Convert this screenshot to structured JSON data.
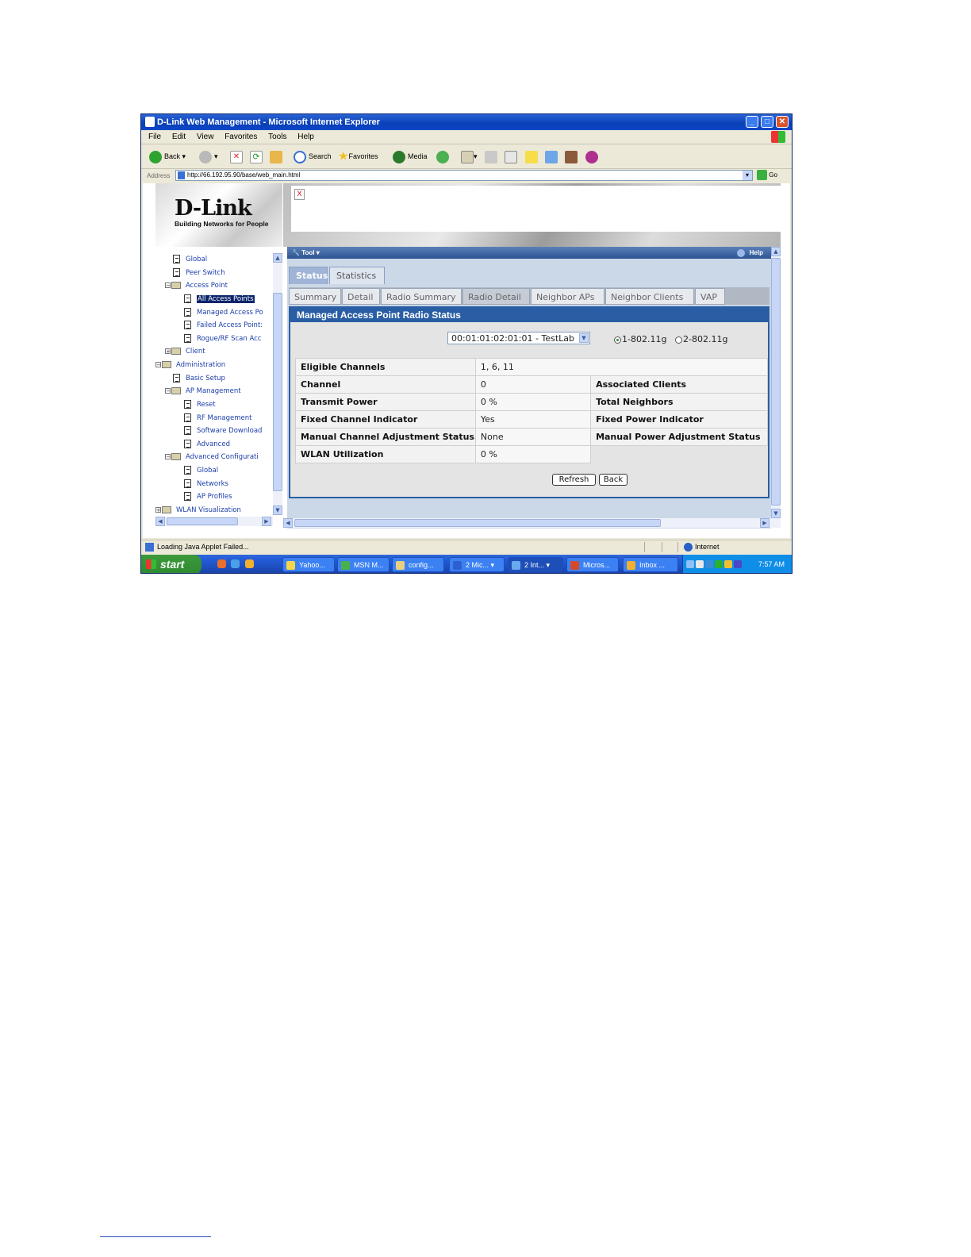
{
  "window": {
    "title": "D-Link Web Management - Microsoft Internet Explorer",
    "controls": [
      "minimize",
      "maximize",
      "close"
    ]
  },
  "menu": [
    "File",
    "Edit",
    "View",
    "Favorites",
    "Tools",
    "Help"
  ],
  "toolbar": {
    "back": "Back",
    "search": "Search",
    "favorites": "Favorites",
    "media": "Media"
  },
  "address": {
    "label": "Address",
    "url": "http://66.192.95.90/base/web_main.html",
    "go": "Go"
  },
  "logo": {
    "brand": "D-Link",
    "slogan": "Building Networks for People"
  },
  "nav_tree": [
    {
      "label": "Global"
    },
    {
      "label": "Peer Switch"
    },
    {
      "label": "Access Point"
    },
    {
      "label": "All Access Points"
    },
    {
      "label": "Managed Access Po"
    },
    {
      "label": "Failed Access Point:"
    },
    {
      "label": "Rogue/RF Scan Acc"
    },
    {
      "label": "Client"
    },
    {
      "label": "Administration"
    },
    {
      "label": "Basic Setup"
    },
    {
      "label": "AP Management"
    },
    {
      "label": "Reset"
    },
    {
      "label": "RF Management"
    },
    {
      "label": "Software Download"
    },
    {
      "label": "Advanced"
    },
    {
      "label": "Advanced Configurati"
    },
    {
      "label": "Global"
    },
    {
      "label": "Networks"
    },
    {
      "label": "AP Profiles"
    },
    {
      "label": "WLAN Visualization"
    }
  ],
  "tool_header": {
    "tool": "Tool",
    "help": "Help"
  },
  "tabs_primary": [
    "Status",
    "Statistics"
  ],
  "tabs_secondary": [
    "Summary",
    "Detail",
    "Radio Summary",
    "Radio Detail",
    "Neighbor APs",
    "Neighbor Clients",
    "VAP"
  ],
  "section_title": "Managed Access Point Radio Status",
  "ap_select": {
    "value": "00:01:01:02:01:01 - TestLab"
  },
  "radios": [
    {
      "label": "1-802.11g",
      "checked": true
    },
    {
      "label": "2-802.11g",
      "checked": false
    }
  ],
  "status_rows": [
    {
      "label": "Eligible Channels",
      "value": "1, 6, 11",
      "label2": ""
    },
    {
      "label": "Channel",
      "value": "0",
      "label2": "Associated Clients"
    },
    {
      "label": "Transmit Power",
      "value": "0 %",
      "label2": "Total Neighbors"
    },
    {
      "label": "Fixed Channel Indicator",
      "value": "Yes",
      "label2": "Fixed Power Indicator"
    },
    {
      "label": "Manual Channel Adjustment Status",
      "value": "None",
      "label2": "Manual Power Adjustment Status"
    },
    {
      "label": "WLAN Utilization",
      "value": "0 %",
      "label2": ""
    }
  ],
  "buttons": {
    "refresh": "Refresh",
    "back": "Back"
  },
  "statusbar": {
    "message": "Loading Java Applet Failed...",
    "zone": "Internet"
  },
  "taskbar": {
    "start": "start",
    "tasks": [
      "Yahoo...",
      "MSN M...",
      "config...",
      "2 Mic...",
      "2 Int...",
      "Micros...",
      "Inbox ..."
    ],
    "clock": "7:57 AM"
  }
}
